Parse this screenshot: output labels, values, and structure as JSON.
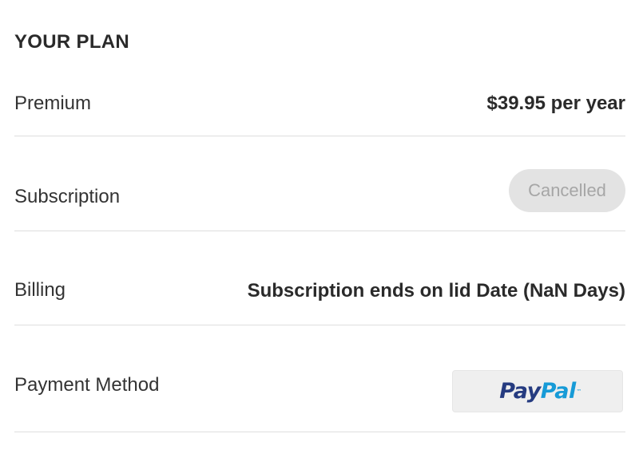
{
  "plan": {
    "title": "YOUR PLAN",
    "rows": {
      "premium": {
        "label": "Premium",
        "value": "$39.95 per year"
      },
      "subscription": {
        "label": "Subscription",
        "status": "Cancelled"
      },
      "billing": {
        "label": "Billing",
        "value": "Subscription ends on lid Date (NaN Days)"
      },
      "payment": {
        "label": "Payment Method",
        "method": {
          "logo_part1": "Pay",
          "logo_part2": "Pal",
          "trademark": "™",
          "icon": "paypal-logo",
          "colors": {
            "pay": "#253b80",
            "pal": "#179bd7"
          }
        }
      }
    }
  },
  "colors": {
    "text": "#2f2f2f",
    "divider": "#dedede",
    "status_pill_bg": "#e3e3e3",
    "status_pill_text": "#a6a6a6",
    "payment_button_bg": "#efefef"
  }
}
